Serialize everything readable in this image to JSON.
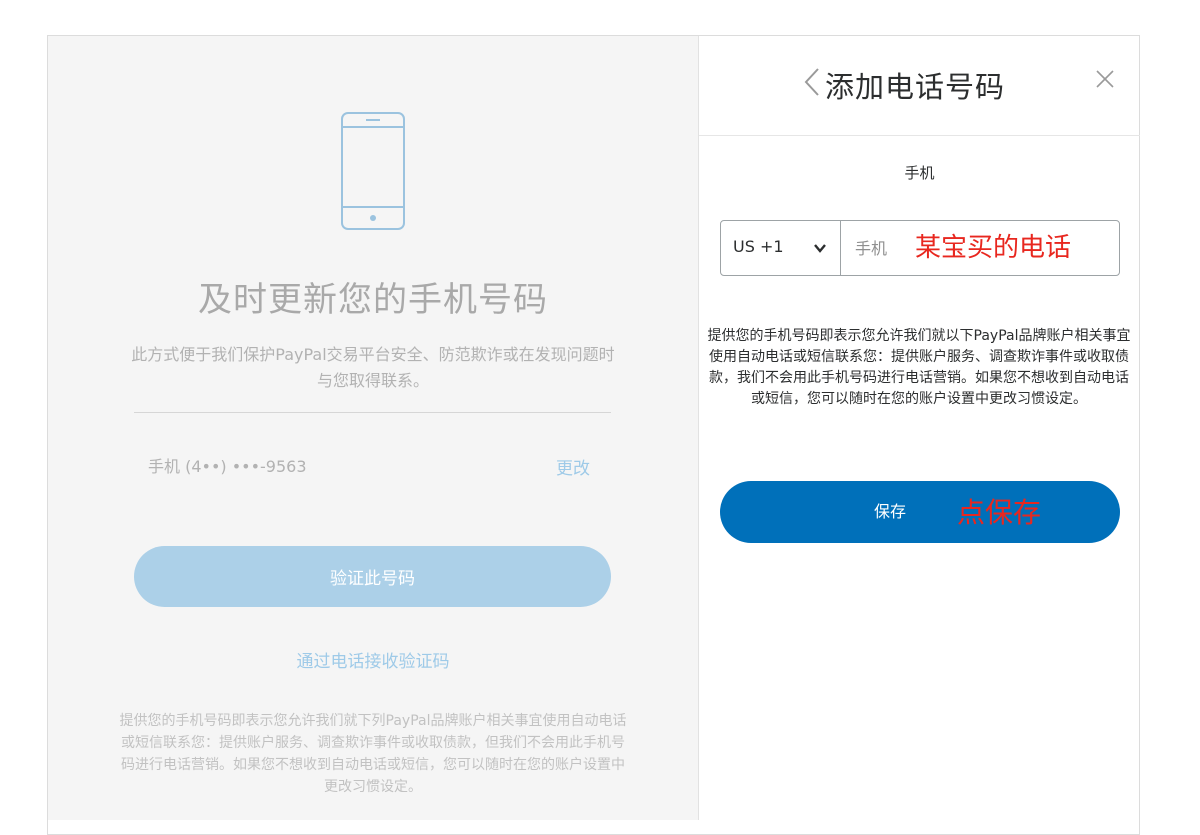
{
  "background_page": {
    "title": "及时更新您的手机号码",
    "description": "此方式便于我们保护PayPal交易平台安全、防范欺诈或在发现问题时与您取得联系。",
    "phone_number": "手机 (4••) •••-9563",
    "change_label": "更改",
    "verify_button_label": "验证此号码",
    "call_link_label": "通过电话接收验证码",
    "disclaimer": "提供您的手机号码即表示您允许我们就下列PayPal品牌账户相关事宜使用自动电话或短信联系您：提供账户服务、调查欺诈事件或收取债款，但我们不会用此手机号码进行电话营销。如果您不想收到自动电话或短信，您可以随时在您的账户设置中更改习惯设定。"
  },
  "dialog": {
    "title": "添加电话号码",
    "field_label": "手机",
    "country_code": "US +1",
    "phone_placeholder": "手机",
    "phone_value": "",
    "disclaimer": "提供您的手机号码即表示您允许我们就以下PayPal品牌账户相关事宜使用自动电话或短信联系您：提供账户服务、调查欺诈事件或收取债款，我们不会用此手机号码进行电话营销。如果您不想收到自动电话或短信，您可以随时在您的账户设置中更改习惯设定。",
    "save_button_label": "保存"
  },
  "annotations": {
    "phone_note": "某宝买的电话",
    "save_note": "点保存"
  },
  "colors": {
    "primary_blue": "#0070ba",
    "disabled_blue": "#acd0e8",
    "link_blue": "#9ecae8",
    "annotation_red": "#e8271f"
  },
  "icons": {
    "phone": "smartphone-outline-icon",
    "back": "chevron-left-icon",
    "close": "close-icon",
    "dropdown": "chevron-down-icon"
  }
}
